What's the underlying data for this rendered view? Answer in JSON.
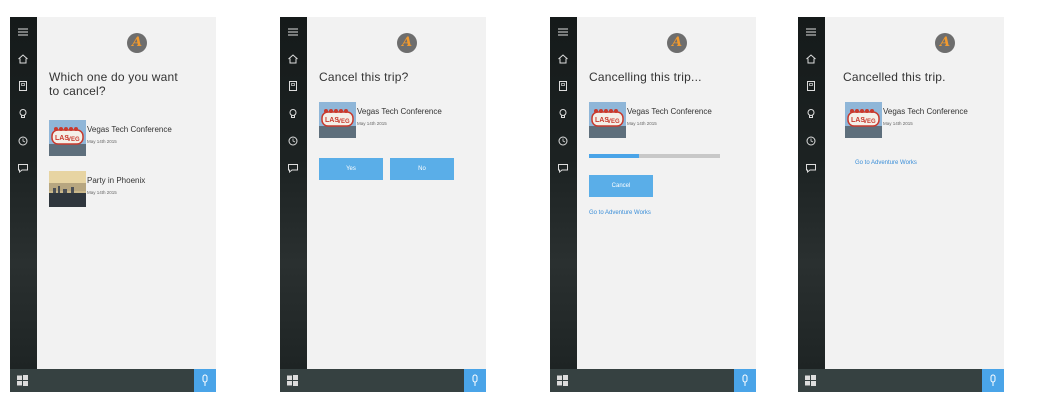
{
  "colors": {
    "accent": "#4aa4e8",
    "rail": "#1c2222",
    "taskbar": "#364141",
    "content_bg": "#f2f2f2",
    "avatar_letter": "#f29a2e"
  },
  "avatar_letter": "A",
  "rail_icons": [
    "hamburger-icon",
    "home-icon",
    "notebook-icon",
    "lightbulb-icon",
    "history-icon",
    "feedback-icon"
  ],
  "panel1": {
    "title_line1": "Which one do you want",
    "title_line2": "to cancel?",
    "trips": [
      {
        "name": "Vegas Tech Conference",
        "date": "May 14th 2015",
        "image": "vegas-sign"
      },
      {
        "name": "Party in Phoenix",
        "date": "May 14th 2015",
        "image": "phoenix-skyline"
      }
    ]
  },
  "panel2": {
    "title": "Cancel this trip?",
    "trip": {
      "name": "Vegas Tech Conference",
      "date": "May 14th 2015"
    },
    "yes_label": "Yes",
    "no_label": "No"
  },
  "panel3": {
    "title": "Cancelling this trip...",
    "trip": {
      "name": "Vegas Tech Conference",
      "date": "May 14th 2015"
    },
    "progress": 0.38,
    "cancel_label": "Cancel",
    "link": "Go to Adventure Works"
  },
  "panel4": {
    "title": "Cancelled this trip.",
    "trip": {
      "name": "Vegas Tech Conference",
      "date": "May 14th 2015"
    },
    "link": "Go to Adventure Works"
  }
}
